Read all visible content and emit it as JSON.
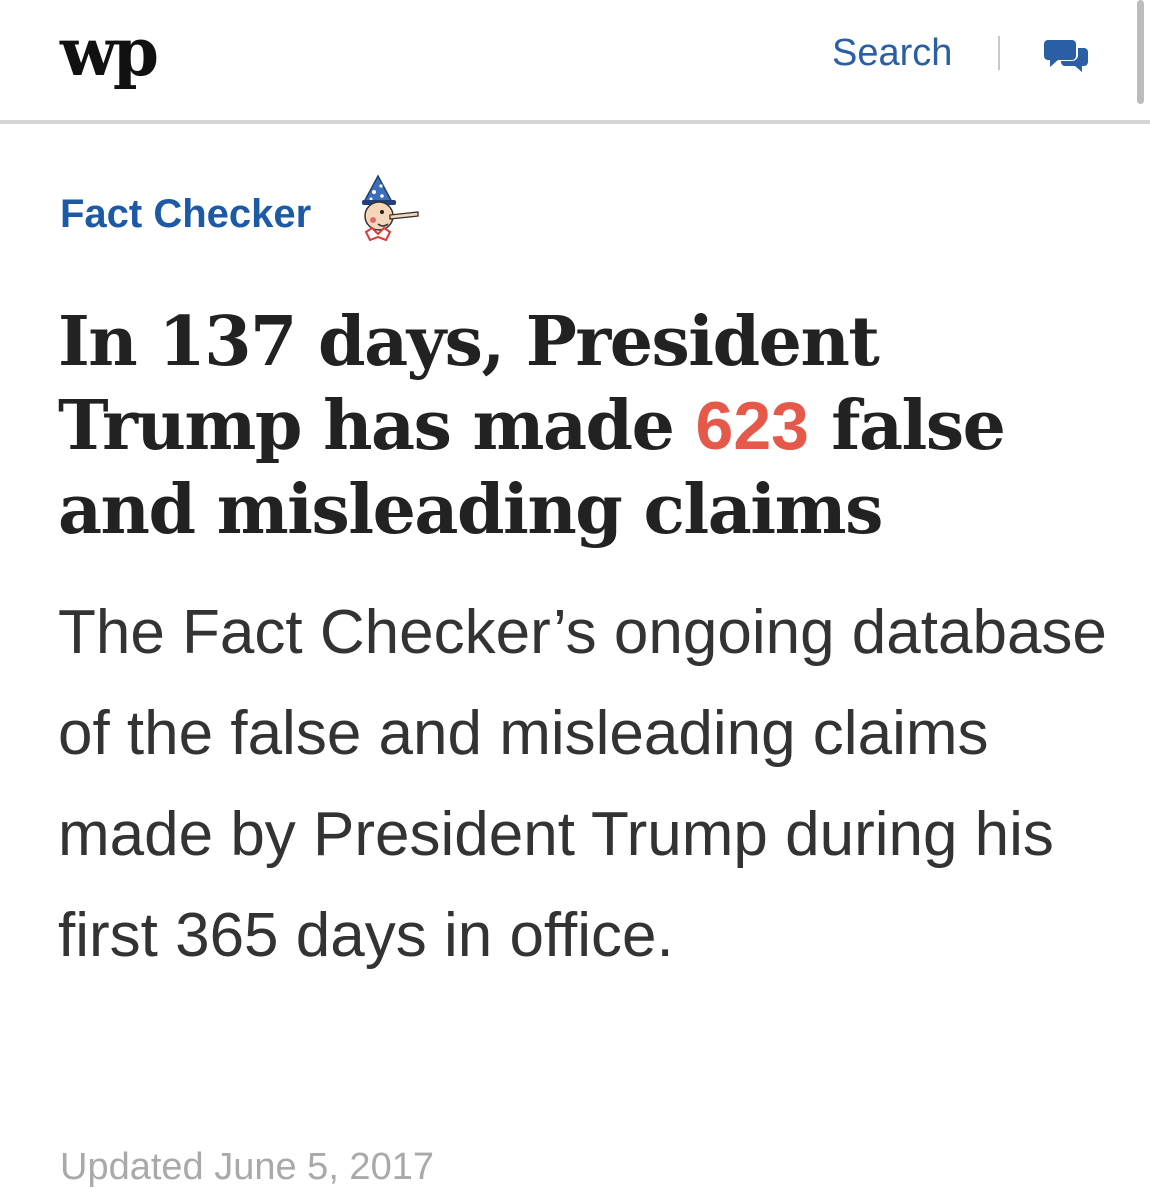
{
  "header": {
    "logo_text": "wp",
    "search_label": "Search",
    "comments_icon": "comments-icon"
  },
  "article": {
    "kicker": "Fact Checker",
    "mascot_icon": "pinocchio-icon",
    "headline": {
      "before": "In 137 days, President Trump has made ",
      "number": "623",
      "after": " false and misleading claims"
    },
    "dek": "The Fact Checker’s ongoing database of the false and misleading claims made by President Trump during his first 365 days in office.",
    "updated": "Updated June 5, 2017"
  },
  "colors": {
    "accent_blue": "#1d5aa6",
    "link_blue": "#2a5ea5",
    "highlight_red": "#e5594a",
    "muted_gray": "#a9a9a9"
  }
}
